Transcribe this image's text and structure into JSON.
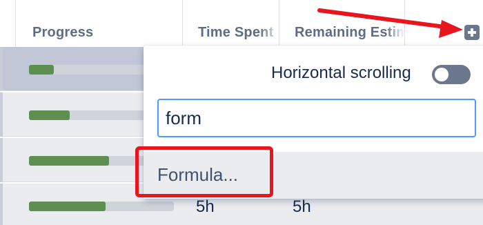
{
  "table": {
    "columns": [
      {
        "label": "Progress"
      },
      {
        "label": "Time Spent"
      },
      {
        "label": "Remaining Estimate"
      }
    ],
    "add_column_icon": "plus-square-icon",
    "rows": [
      {
        "progress": 0.17,
        "time_spent": "",
        "remaining": "",
        "selected": true
      },
      {
        "progress": 0.28,
        "time_spent": "",
        "remaining": ""
      },
      {
        "progress": 0.55,
        "time_spent": "",
        "remaining": ""
      },
      {
        "progress": 0.53,
        "time_spent": "5h",
        "remaining": "5h"
      }
    ]
  },
  "dropdown": {
    "horizontal_scrolling_label": "Horizontal scrolling",
    "horizontal_scrolling_on": false,
    "search_value": "form",
    "menu_items": [
      {
        "label": "Formula..."
      }
    ]
  },
  "annotations": {
    "arrow_color": "#e8141e",
    "highlight_color": "#e8141e"
  },
  "colors": {
    "progress_fill": "#5c8f50",
    "progress_track": "#cfd3da",
    "focus_border": "#4c9aff"
  }
}
